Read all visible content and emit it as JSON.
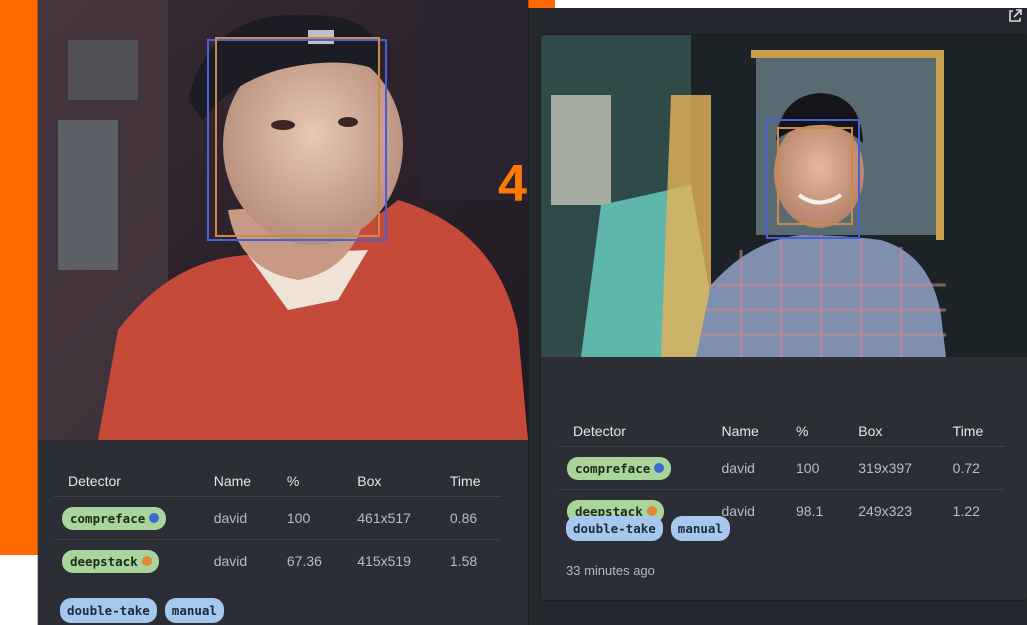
{
  "overlay_number": "4",
  "colors": {
    "accent_orange": "#ff6a00",
    "card_bg": "#2b2f35",
    "detector_pill": "#a9d49b",
    "tag_pill": "#a7c8ee",
    "compreface_dot": "#3b6ad6",
    "deepstack_dot": "#e0883a"
  },
  "table_headers": {
    "detector": "Detector",
    "name": "Name",
    "percent": "%",
    "box": "Box",
    "time": "Time"
  },
  "left_card": {
    "rows": [
      {
        "detector": "compreface",
        "name": "david",
        "percent": "100",
        "box": "461x517",
        "time": "0.86"
      },
      {
        "detector": "deepstack",
        "name": "david",
        "percent": "67.36",
        "box": "415x519",
        "time": "1.58"
      }
    ],
    "tags": [
      "double-take",
      "manual"
    ]
  },
  "right_card": {
    "rows": [
      {
        "detector": "compreface",
        "name": "david",
        "percent": "100",
        "box": "319x397",
        "time": "0.72"
      },
      {
        "detector": "deepstack",
        "name": "david",
        "percent": "98.1",
        "box": "249x323",
        "time": "1.22"
      }
    ],
    "tags": [
      "double-take",
      "manual"
    ],
    "time_ago": "33 minutes ago"
  },
  "icons": {
    "open_external": "external-link-icon"
  }
}
